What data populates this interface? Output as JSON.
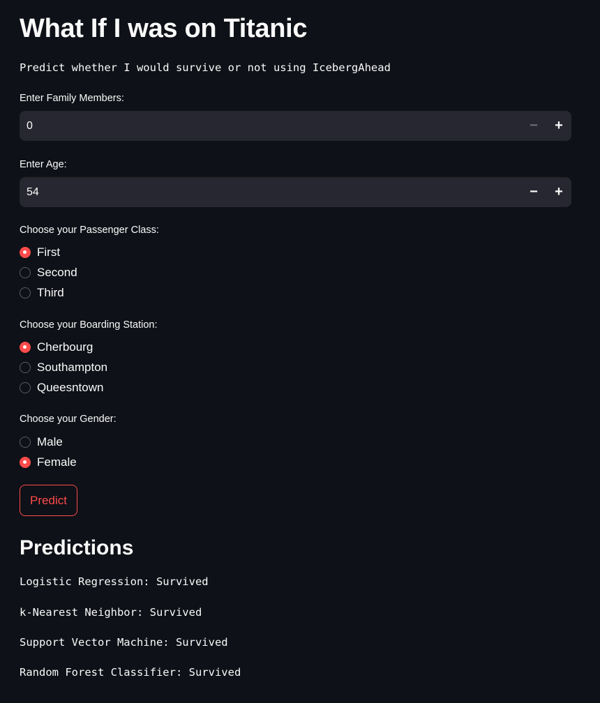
{
  "header": {
    "title": "What If I was on Titanic",
    "subtitle": "Predict whether I would survive or not using IcebergAhead"
  },
  "family": {
    "label": "Enter Family Members:",
    "value": "0",
    "minus": "−",
    "plus": "+"
  },
  "age": {
    "label": "Enter Age:",
    "value": "54",
    "minus": "−",
    "plus": "+"
  },
  "passenger_class": {
    "label": "Choose your Passenger Class:",
    "options": [
      "First",
      "Second",
      "Third"
    ],
    "selected": "First"
  },
  "boarding_station": {
    "label": "Choose your Boarding Station:",
    "options": [
      "Cherbourg",
      "Southampton",
      "Queesntown"
    ],
    "selected": "Cherbourg"
  },
  "gender": {
    "label": "Choose your Gender:",
    "options": [
      "Male",
      "Female"
    ],
    "selected": "Female"
  },
  "predict_button": {
    "label": "Predict"
  },
  "predictions": {
    "title": "Predictions",
    "items": [
      "Logistic Regression: Survived",
      "k-Nearest Neighbor: Survived",
      "Support Vector Machine: Survived",
      "Random Forest Classifier: Survived"
    ]
  },
  "colors": {
    "background": "#0e1117",
    "input_bg": "#262730",
    "accent": "#ff4b4b",
    "text": "#fafafa"
  }
}
